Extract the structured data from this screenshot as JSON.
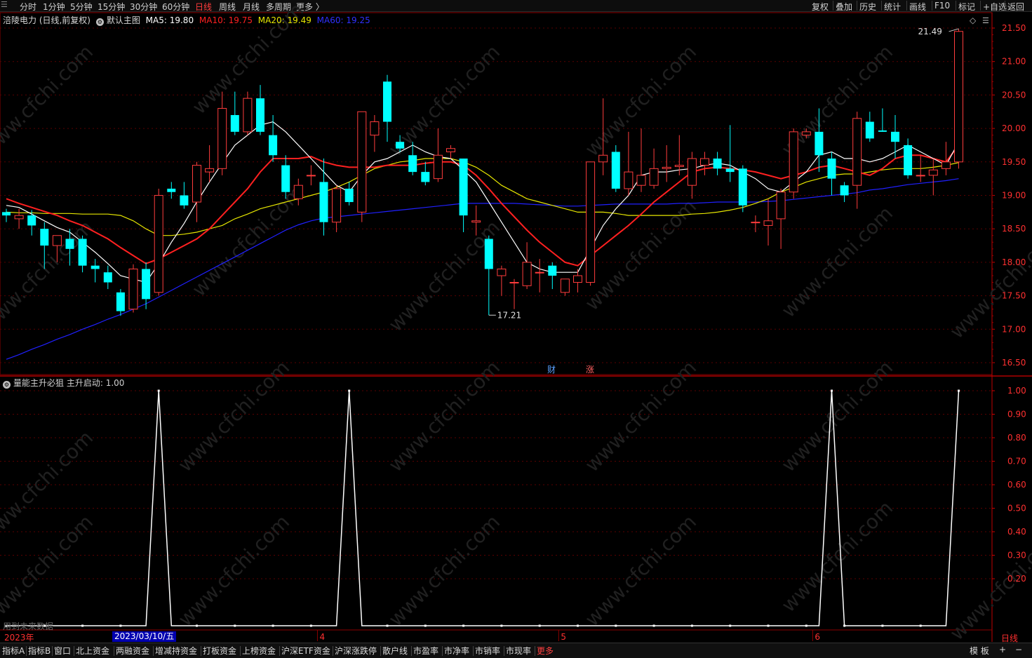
{
  "toolbar": {
    "periods": [
      "分时",
      "1分钟",
      "5分钟",
      "15分钟",
      "30分钟",
      "60分钟",
      "日线",
      "周线",
      "月线",
      "多周期",
      "更多 〉"
    ],
    "active_period": "日线",
    "right_tools": [
      "复权",
      "叠加",
      "历史",
      "统计",
      "画线",
      "F10",
      "标记",
      "+自选",
      "返回"
    ]
  },
  "main_chart": {
    "stock_label": "涪陵电力 (日线,前复权)",
    "template_label": "默认主图",
    "ma": [
      {
        "label": "MA5: 19.80",
        "color": "#ffffff"
      },
      {
        "label": "MA10: 19.75",
        "color": "#ff2020"
      },
      {
        "label": "MA20: 19.49",
        "color": "#e6e600"
      },
      {
        "label": "MA60: 19.25",
        "color": "#2020ff"
      }
    ],
    "high_label": "21.49",
    "low_label": "17.21",
    "event_badges": [
      "财",
      "涨"
    ]
  },
  "indicator": {
    "label": "量能主升必狙",
    "value_label": "主升启动: 1.00",
    "future_label": "用到未来数据"
  },
  "x_axis": {
    "year": "2023年",
    "cursor_date": "2023/03/10/五",
    "month_labels": [
      "4",
      "5",
      "6"
    ],
    "period_label": "日线"
  },
  "bottom_tabs": [
    "指标A",
    "指标B",
    "窗口",
    "北上资金",
    "两融资金",
    "增减持资金",
    "打板资金",
    "上榜资金",
    "沪深ETF资金",
    "沪深涨跌停",
    "散户线",
    "市盈率",
    "市净率",
    "市销率",
    "市现率",
    "更多"
  ],
  "bottom_right": [
    "模 板",
    "+",
    "−"
  ],
  "colors": {
    "up": "#ff3c3c",
    "down": "#00ffff",
    "grid": "#8b0000",
    "axis": "#ff2020"
  },
  "watermark": "www.cfchi.com",
  "chart_data": [
    {
      "type": "candlestick",
      "title": "涪陵电力 (日线,前复权)",
      "y_ticks": [
        21.5,
        21.0,
        20.5,
        20.0,
        19.5,
        19.0,
        18.5,
        18.0,
        17.5,
        17.0,
        16.5
      ],
      "ylim": [
        16.4,
        21.6
      ],
      "candles": [
        {
          "o": 18.75,
          "h": 18.8,
          "l": 18.6,
          "c": 18.7
        },
        {
          "o": 18.65,
          "h": 18.8,
          "l": 18.5,
          "c": 18.7
        },
        {
          "o": 18.7,
          "h": 18.78,
          "l": 18.4,
          "c": 18.55
        },
        {
          "o": 18.5,
          "h": 18.6,
          "l": 17.9,
          "c": 18.25
        },
        {
          "o": 18.25,
          "h": 18.4,
          "l": 18.0,
          "c": 18.4
        },
        {
          "o": 18.35,
          "h": 18.5,
          "l": 17.95,
          "c": 18.2
        },
        {
          "o": 18.35,
          "h": 18.4,
          "l": 17.85,
          "c": 17.95
        },
        {
          "o": 17.95,
          "h": 18.05,
          "l": 17.7,
          "c": 17.9
        },
        {
          "o": 17.85,
          "h": 17.95,
          "l": 17.6,
          "c": 17.7
        },
        {
          "o": 17.55,
          "h": 17.6,
          "l": 17.2,
          "c": 17.27
        },
        {
          "o": 17.3,
          "h": 17.97,
          "l": 17.25,
          "c": 17.9
        },
        {
          "o": 17.9,
          "h": 18.0,
          "l": 17.3,
          "c": 17.45
        },
        {
          "o": 17.55,
          "h": 19.1,
          "l": 17.5,
          "c": 19.0
        },
        {
          "o": 19.1,
          "h": 19.2,
          "l": 18.95,
          "c": 19.05
        },
        {
          "o": 19.0,
          "h": 19.2,
          "l": 18.8,
          "c": 18.85
        },
        {
          "o": 18.9,
          "h": 19.5,
          "l": 18.6,
          "c": 19.45
        },
        {
          "o": 19.35,
          "h": 19.75,
          "l": 19.2,
          "c": 19.4
        },
        {
          "o": 19.4,
          "h": 20.55,
          "l": 19.3,
          "c": 20.3
        },
        {
          "o": 20.2,
          "h": 20.55,
          "l": 19.9,
          "c": 19.95
        },
        {
          "o": 19.95,
          "h": 20.55,
          "l": 19.9,
          "c": 20.45
        },
        {
          "o": 20.45,
          "h": 20.65,
          "l": 19.9,
          "c": 19.95
        },
        {
          "o": 19.9,
          "h": 20.2,
          "l": 19.5,
          "c": 19.6
        },
        {
          "o": 19.45,
          "h": 19.6,
          "l": 18.95,
          "c": 19.05
        },
        {
          "o": 18.95,
          "h": 19.25,
          "l": 18.85,
          "c": 19.15
        },
        {
          "o": 19.3,
          "h": 19.45,
          "l": 19.15,
          "c": 19.3
        },
        {
          "o": 19.2,
          "h": 19.55,
          "l": 18.4,
          "c": 18.6
        },
        {
          "o": 18.6,
          "h": 19.15,
          "l": 18.45,
          "c": 19.1
        },
        {
          "o": 19.1,
          "h": 19.2,
          "l": 18.85,
          "c": 18.9
        },
        {
          "o": 18.75,
          "h": 20.25,
          "l": 18.6,
          "c": 20.25
        },
        {
          "o": 19.9,
          "h": 20.2,
          "l": 19.65,
          "c": 20.1
        },
        {
          "o": 20.7,
          "h": 20.8,
          "l": 19.8,
          "c": 20.1
        },
        {
          "o": 19.8,
          "h": 19.9,
          "l": 19.65,
          "c": 19.7
        },
        {
          "o": 19.6,
          "h": 19.8,
          "l": 19.3,
          "c": 19.35
        },
        {
          "o": 19.35,
          "h": 19.5,
          "l": 19.15,
          "c": 19.2
        },
        {
          "o": 19.25,
          "h": 20.0,
          "l": 19.2,
          "c": 19.6
        },
        {
          "o": 19.65,
          "h": 19.75,
          "l": 19.55,
          "c": 19.7
        },
        {
          "o": 19.55,
          "h": 19.55,
          "l": 18.45,
          "c": 18.7
        },
        {
          "o": 18.6,
          "h": 18.85,
          "l": 18.4,
          "c": 18.62
        },
        {
          "o": 18.35,
          "h": 18.4,
          "l": 17.21,
          "c": 17.9
        },
        {
          "o": 17.8,
          "h": 17.95,
          "l": 17.5,
          "c": 17.9
        },
        {
          "o": 17.7,
          "h": 17.75,
          "l": 17.3,
          "c": 17.7
        },
        {
          "o": 17.65,
          "h": 18.3,
          "l": 17.6,
          "c": 18.0
        },
        {
          "o": 17.85,
          "h": 18.05,
          "l": 17.55,
          "c": 17.85
        },
        {
          "o": 17.95,
          "h": 18.0,
          "l": 17.6,
          "c": 17.8
        },
        {
          "o": 17.55,
          "h": 17.75,
          "l": 17.5,
          "c": 17.75
        },
        {
          "o": 17.7,
          "h": 17.9,
          "l": 17.55,
          "c": 17.8
        },
        {
          "o": 17.7,
          "h": 19.5,
          "l": 17.65,
          "c": 19.5
        },
        {
          "o": 19.5,
          "h": 20.45,
          "l": 19.3,
          "c": 19.6
        },
        {
          "o": 19.65,
          "h": 19.75,
          "l": 19.05,
          "c": 19.1
        },
        {
          "o": 19.1,
          "h": 19.95,
          "l": 19.0,
          "c": 19.35
        },
        {
          "o": 19.15,
          "h": 20.0,
          "l": 19.05,
          "c": 19.3
        },
        {
          "o": 19.15,
          "h": 19.7,
          "l": 19.1,
          "c": 19.4
        },
        {
          "o": 19.4,
          "h": 19.75,
          "l": 19.2,
          "c": 19.42
        },
        {
          "o": 19.43,
          "h": 19.9,
          "l": 19.3,
          "c": 19.45
        },
        {
          "o": 19.15,
          "h": 19.65,
          "l": 18.95,
          "c": 19.55
        },
        {
          "o": 19.45,
          "h": 19.65,
          "l": 19.3,
          "c": 19.55
        },
        {
          "o": 19.55,
          "h": 19.65,
          "l": 19.3,
          "c": 19.4
        },
        {
          "o": 19.4,
          "h": 20.05,
          "l": 19.2,
          "c": 19.35
        },
        {
          "o": 19.4,
          "h": 19.45,
          "l": 18.75,
          "c": 18.85
        },
        {
          "o": 18.6,
          "h": 18.7,
          "l": 18.45,
          "c": 18.6
        },
        {
          "o": 18.55,
          "h": 18.95,
          "l": 18.25,
          "c": 18.62
        },
        {
          "o": 18.65,
          "h": 19.1,
          "l": 18.2,
          "c": 19.05
        },
        {
          "o": 19.05,
          "h": 20.0,
          "l": 18.95,
          "c": 19.95
        },
        {
          "o": 19.9,
          "h": 20.0,
          "l": 19.85,
          "c": 19.95
        },
        {
          "o": 19.95,
          "h": 20.3,
          "l": 19.35,
          "c": 19.6
        },
        {
          "o": 19.55,
          "h": 19.65,
          "l": 19.0,
          "c": 19.25
        },
        {
          "o": 19.15,
          "h": 19.2,
          "l": 18.9,
          "c": 19.0
        },
        {
          "o": 19.15,
          "h": 20.25,
          "l": 18.8,
          "c": 20.15
        },
        {
          "o": 20.1,
          "h": 20.25,
          "l": 19.8,
          "c": 19.85
        },
        {
          "o": 19.97,
          "h": 20.3,
          "l": 19.95,
          "c": 19.95
        },
        {
          "o": 19.95,
          "h": 20.2,
          "l": 19.55,
          "c": 19.8
        },
        {
          "o": 19.75,
          "h": 19.85,
          "l": 19.25,
          "c": 19.3
        },
        {
          "o": 19.3,
          "h": 19.6,
          "l": 19.2,
          "c": 19.3
        },
        {
          "o": 19.3,
          "h": 19.55,
          "l": 19.0,
          "c": 19.38
        },
        {
          "o": 19.4,
          "h": 19.8,
          "l": 19.3,
          "c": 19.5
        },
        {
          "o": 19.5,
          "h": 21.49,
          "l": 19.4,
          "c": 21.45
        }
      ],
      "ma_series": [
        {
          "name": "MA5",
          "color": "#ffffff",
          "values": [
            18.85,
            18.82,
            18.72,
            18.62,
            18.52,
            18.45,
            18.3,
            18.15,
            17.98,
            17.8,
            17.75,
            17.7,
            17.98,
            18.3,
            18.58,
            18.9,
            19.2,
            19.48,
            19.75,
            19.9,
            20.05,
            20.1,
            19.95,
            19.75,
            19.55,
            19.35,
            19.15,
            19.05,
            19.3,
            19.5,
            19.55,
            19.65,
            19.75,
            19.65,
            19.58,
            19.55,
            19.38,
            19.2,
            18.9,
            18.6,
            18.3,
            18.0,
            17.9,
            17.85,
            17.85,
            17.85,
            18.2,
            18.55,
            18.8,
            19.0,
            19.3,
            19.35,
            19.35,
            19.38,
            19.4,
            19.45,
            19.48,
            19.45,
            19.35,
            19.25,
            19.1,
            19.05,
            19.2,
            19.35,
            19.6,
            19.65,
            19.55,
            19.55,
            19.5,
            19.55,
            19.65,
            19.75,
            19.65,
            19.55,
            19.45,
            19.8
          ]
        },
        {
          "name": "MA10",
          "color": "#ff2020",
          "values": [
            18.95,
            18.88,
            18.82,
            18.76,
            18.7,
            18.62,
            18.55,
            18.45,
            18.35,
            18.22,
            18.1,
            17.98,
            18.05,
            18.15,
            18.25,
            18.35,
            18.5,
            18.7,
            18.9,
            19.1,
            19.35,
            19.55,
            19.55,
            19.55,
            19.58,
            19.5,
            19.45,
            19.42,
            19.42,
            19.42,
            19.45,
            19.45,
            19.45,
            19.48,
            19.5,
            19.5,
            19.45,
            19.3,
            19.1,
            18.88,
            18.68,
            18.48,
            18.3,
            18.15,
            18.0,
            17.95,
            18.1,
            18.25,
            18.4,
            18.55,
            18.72,
            18.9,
            19.05,
            19.2,
            19.35,
            19.4,
            19.42,
            19.4,
            19.38,
            19.35,
            19.3,
            19.25,
            19.3,
            19.35,
            19.42,
            19.45,
            19.4,
            19.35,
            19.3,
            19.4,
            19.55,
            19.6,
            19.6,
            19.55,
            19.5,
            19.75
          ]
        },
        {
          "name": "MA20",
          "color": "#e6e600",
          "values": [
            18.75,
            18.74,
            18.74,
            18.73,
            18.73,
            18.73,
            18.72,
            18.72,
            18.72,
            18.7,
            18.62,
            18.5,
            18.4,
            18.4,
            18.42,
            18.45,
            18.5,
            18.55,
            18.65,
            18.72,
            18.8,
            18.85,
            18.9,
            18.95,
            19.0,
            19.05,
            19.12,
            19.2,
            19.3,
            19.4,
            19.45,
            19.5,
            19.52,
            19.55,
            19.55,
            19.55,
            19.5,
            19.42,
            19.3,
            19.15,
            19.05,
            18.95,
            18.9,
            18.85,
            18.8,
            18.75,
            18.75,
            18.75,
            18.73,
            18.7,
            18.7,
            18.7,
            18.7,
            18.7,
            18.72,
            18.73,
            18.75,
            18.78,
            18.82,
            18.88,
            18.95,
            19.05,
            19.12,
            19.2,
            19.25,
            19.3,
            19.32,
            19.32,
            19.35,
            19.38,
            19.4,
            19.4,
            19.4,
            19.42,
            19.45,
            19.49
          ]
        },
        {
          "name": "MA60",
          "color": "#2020ff",
          "values": [
            16.55,
            16.62,
            16.7,
            16.77,
            16.85,
            16.92,
            17.0,
            17.07,
            17.15,
            17.22,
            17.3,
            17.38,
            17.48,
            17.58,
            17.68,
            17.78,
            17.88,
            17.98,
            18.08,
            18.18,
            18.28,
            18.38,
            18.48,
            18.56,
            18.62,
            18.66,
            18.68,
            18.7,
            18.72,
            18.74,
            18.76,
            18.78,
            18.8,
            18.82,
            18.84,
            18.86,
            18.88,
            18.88,
            18.88,
            18.88,
            18.88,
            18.87,
            18.86,
            18.85,
            18.84,
            18.84,
            18.85,
            18.86,
            18.87,
            18.87,
            18.87,
            18.87,
            18.87,
            18.88,
            18.88,
            18.89,
            18.9,
            18.9,
            18.9,
            18.9,
            18.91,
            18.92,
            18.94,
            18.96,
            18.98,
            19.0,
            19.02,
            19.04,
            19.08,
            19.1,
            19.13,
            19.16,
            19.18,
            19.2,
            19.22,
            19.25
          ]
        }
      ]
    },
    {
      "type": "line",
      "title": "量能主升必狙",
      "series": [
        {
          "name": "主升启动",
          "values": [
            0,
            0,
            0,
            0,
            0,
            0,
            0,
            0,
            0,
            0,
            0,
            0,
            1,
            0,
            0,
            0,
            0,
            0,
            0,
            0,
            0,
            0,
            0,
            0,
            0,
            0,
            0,
            1,
            0,
            0,
            0,
            0,
            0,
            0,
            0,
            0,
            0,
            0,
            0,
            0,
            0,
            0,
            0,
            0,
            0,
            0,
            0,
            0,
            0,
            0,
            0,
            0,
            0,
            0,
            0,
            0,
            0,
            0,
            0,
            0,
            0,
            0,
            0,
            0,
            0,
            1,
            0,
            0,
            0,
            0,
            0,
            0,
            0,
            0,
            0,
            1
          ]
        }
      ],
      "y_ticks": [
        1.0,
        0.9,
        0.8,
        0.7,
        0.6,
        0.5,
        0.4,
        0.3,
        0.2
      ],
      "ylim": [
        0,
        1.0
      ]
    }
  ]
}
